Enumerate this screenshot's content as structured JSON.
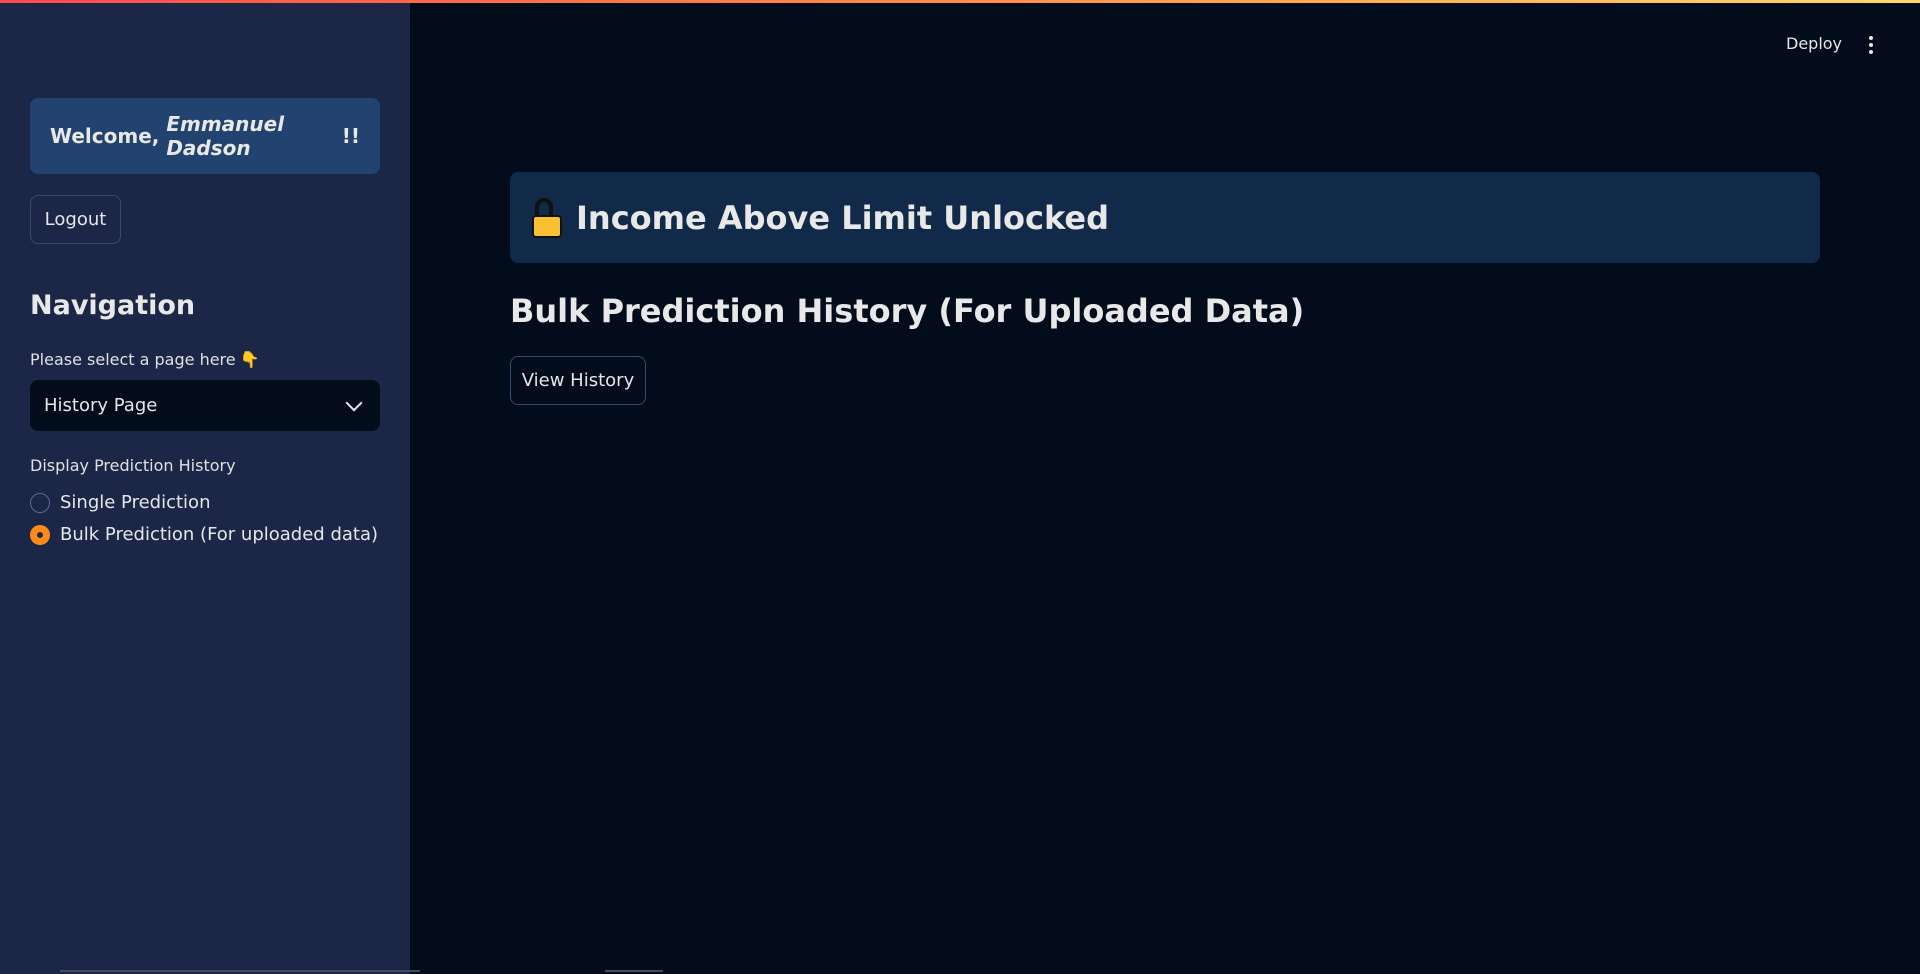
{
  "header": {
    "deploy_label": "Deploy",
    "menu_icon": "kebab-menu-icon"
  },
  "sidebar": {
    "welcome_prefix": "Welcome, ",
    "welcome_name": "Emmanuel Dadson",
    "welcome_suffix": "!!",
    "logout_label": "Logout",
    "nav_title": "Navigation",
    "select_label": "Please select a page here",
    "select_hand": "👇",
    "selected_page": "History Page",
    "radio_group_label": "Display Prediction History",
    "radio_options": [
      {
        "label": "Single Prediction",
        "selected": false
      },
      {
        "label": "Bulk Prediction (For uploaded data)",
        "selected": true
      }
    ]
  },
  "main": {
    "hero_title": "Income Above Limit Unlocked",
    "hero_icon": "unlocked-padlock-icon",
    "section_title": "Bulk Prediction History (For Uploaded Data)",
    "view_history_label": "View History"
  },
  "colors": {
    "accent": "#ff8c1a",
    "sidebar_bg": "#1c2748",
    "main_bg": "#020c1b",
    "hero_bg": "#112a4a"
  }
}
